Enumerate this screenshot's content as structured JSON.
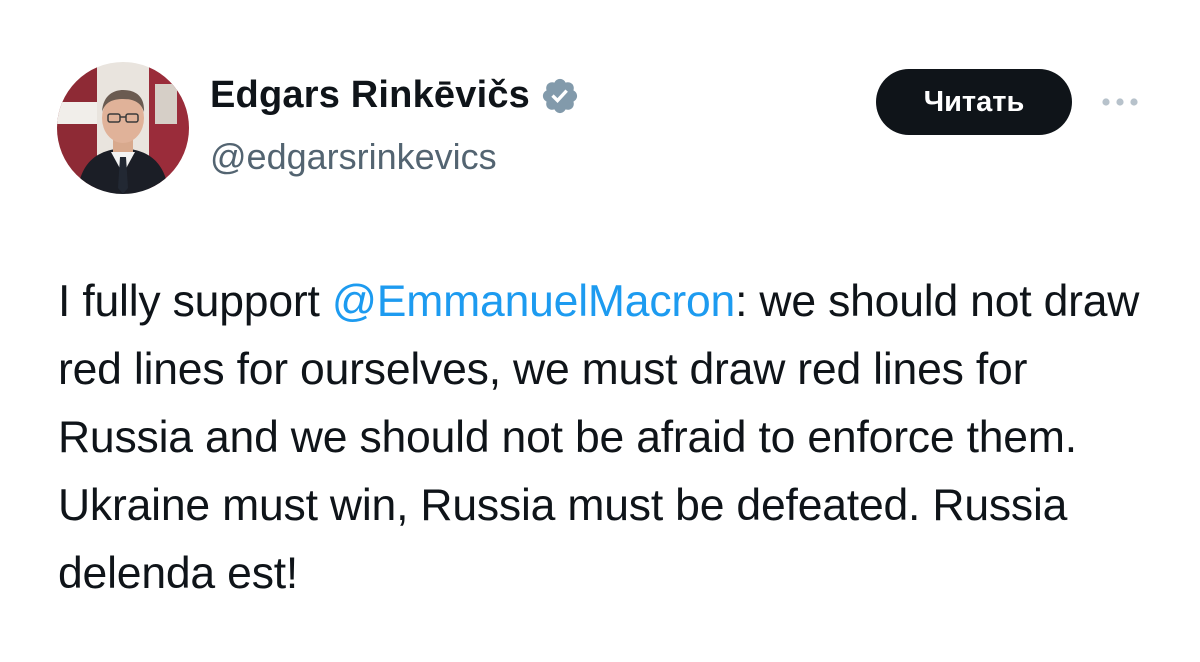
{
  "author": {
    "display_name": "Edgars Rinkēvičs",
    "handle": "@edgarsrinkevics",
    "verified": true,
    "avatar_icon": "profile-photo"
  },
  "actions": {
    "follow_label": "Читать",
    "more_icon": "more-horizontal-icon"
  },
  "tweet": {
    "text_before_mention": "I fully support ",
    "mention": "@EmmanuelMacron",
    "text_after_mention": ": we should not draw red lines for ourselves, we must draw red lines for Russia and we should not be afraid to enforce them. Ukraine must win, Russia must be defeated. Russia delenda est!"
  },
  "colors": {
    "text": "#0f1419",
    "secondary": "#536471",
    "accent": "#1d9bf0",
    "button_bg": "#0f1419",
    "verified_badge": "#829aab"
  }
}
